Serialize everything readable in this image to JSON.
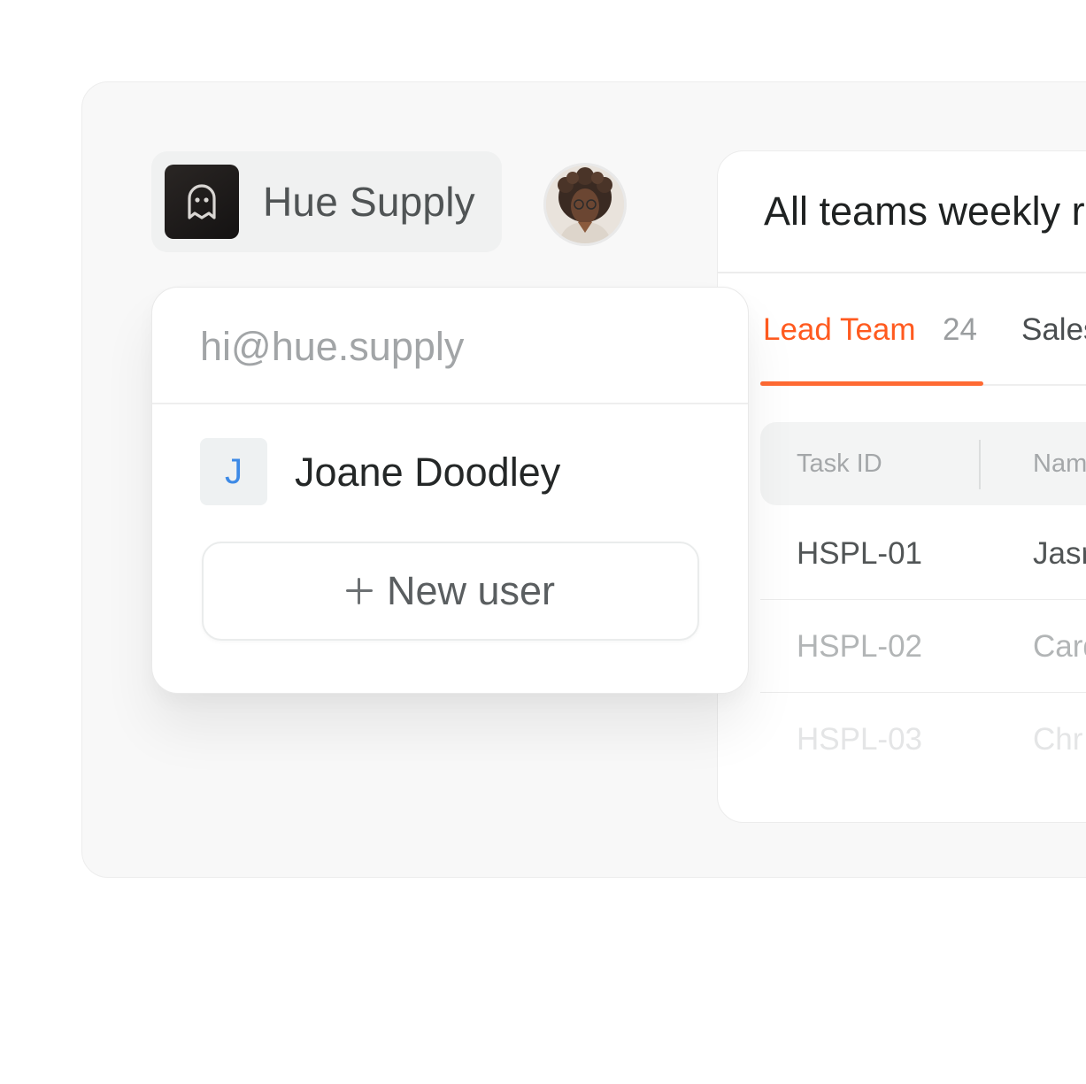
{
  "workspace": {
    "name": "Hue Supply",
    "logo_icon": "ghost-icon"
  },
  "account": {
    "avatar": "user-avatar-photo"
  },
  "dropdown": {
    "email": "hi@hue.supply",
    "users": [
      {
        "initial": "J",
        "name": "Joane Doodley"
      }
    ],
    "new_user_label": "New user",
    "new_user_icon": "plus-icon"
  },
  "report": {
    "title": "All teams weekly r",
    "tabs": [
      {
        "label": "Lead Team",
        "count": "24",
        "active": true
      },
      {
        "label": "Sales"
      }
    ],
    "table": {
      "columns": [
        "Task ID",
        "Nam"
      ],
      "rows": [
        {
          "id": "HSPL-01",
          "name": "Jasr"
        },
        {
          "id": "HSPL-02",
          "name": "Card"
        },
        {
          "id": "HSPL-03",
          "name": "Chr"
        }
      ]
    }
  },
  "colors": {
    "accent": "#ff5a1f",
    "initial_text": "#3d8ae6"
  }
}
